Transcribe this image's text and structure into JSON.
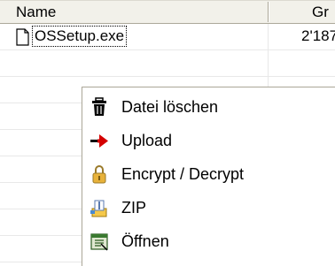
{
  "list": {
    "columns": [
      {
        "label": "Name"
      },
      {
        "label": "Gr"
      }
    ],
    "rows": [
      {
        "name": "OSSetup.exe",
        "size": "2'187"
      }
    ]
  },
  "context_menu": {
    "items": [
      {
        "label": "Datei löschen",
        "icon": "trash-icon"
      },
      {
        "label": "Upload",
        "icon": "upload-arrow-icon"
      },
      {
        "label": "Encrypt / Decrypt",
        "icon": "lock-icon"
      },
      {
        "label": "ZIP",
        "icon": "zip-archive-icon"
      },
      {
        "label": "Öffnen",
        "icon": "open-icon"
      }
    ]
  },
  "colors": {
    "header_bg": "#f2f1ea",
    "upload_arrow": "#d40000",
    "lock": "#e8b23a"
  }
}
